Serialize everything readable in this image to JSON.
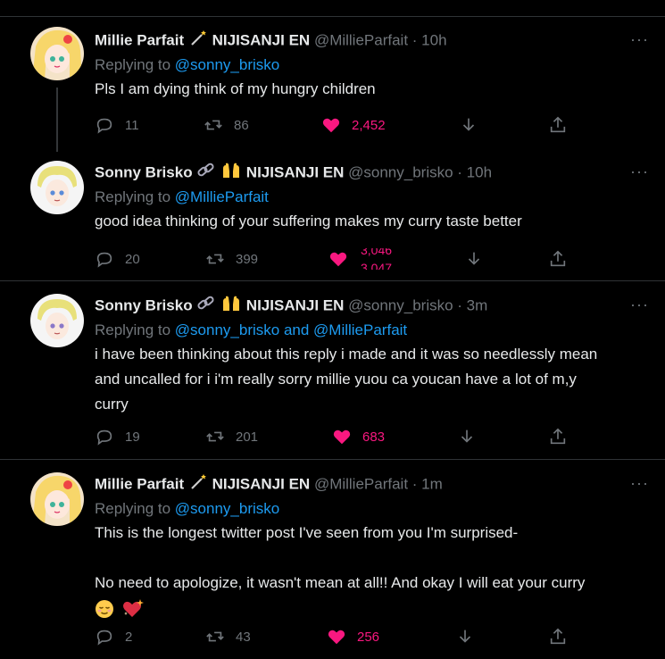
{
  "tweets": [
    {
      "name": "Millie Parfait",
      "badges": [
        "magic-wand-icon"
      ],
      "org": "NIJISANJI EN",
      "handle": "@MillieParfait",
      "time": "· 10h",
      "replying_prefix": "Replying to",
      "replying_to": "@sonny_brisko",
      "text": [
        "Pls I am dying think of my hungry children"
      ],
      "replies": "11",
      "retweets": "86",
      "likes": "2,452"
    },
    {
      "name": "Sonny Brisko",
      "badges": [
        "link-icon",
        "raised-hands-icon"
      ],
      "org": "NIJISANJI EN",
      "handle": "@sonny_brisko",
      "time": "· 10h",
      "replying_prefix": "Replying to",
      "replying_to": "@MillieParfait",
      "text": [
        "good idea thinking of your suffering makes my curry taste better"
      ],
      "replies": "20",
      "retweets": "399",
      "likes": "3,046",
      "likes_next": "3,047"
    },
    {
      "name": "Sonny Brisko",
      "badges": [
        "link-icon",
        "raised-hands-icon"
      ],
      "org": "NIJISANJI EN",
      "handle": "@sonny_brisko",
      "time": "· 3m",
      "replying_prefix": "Replying to",
      "replying_to": "@sonny_brisko and @MillieParfait",
      "text": [
        "i have been thinking about this reply i made and it was so needlessly mean",
        "and uncalled for i i'm really sorry millie yuou ca youcan have a lot of m,y",
        "curry"
      ],
      "replies": "19",
      "retweets": "201",
      "likes": "683"
    },
    {
      "name": "Millie Parfait",
      "badges": [
        "magic-wand-icon"
      ],
      "org": "NIJISANJI EN",
      "handle": "@MillieParfait",
      "time": "· 1m",
      "replying_prefix": "Replying to",
      "replying_to": "@sonny_brisko",
      "text": [
        "This is the longest twitter post I've seen from you I'm surprised-",
        "",
        "No need to apologize, it wasn't mean at all!! And okay I will eat your curry"
      ],
      "emojis": [
        "relieved-face-icon",
        "sparkling-heart-icon"
      ],
      "replies": "2",
      "retweets": "43",
      "likes": "256"
    }
  ],
  "more_label": "···",
  "colors": {
    "accent": "#1d9bf0",
    "like": "#f91880",
    "muted": "#71767b",
    "bg": "#000000"
  }
}
